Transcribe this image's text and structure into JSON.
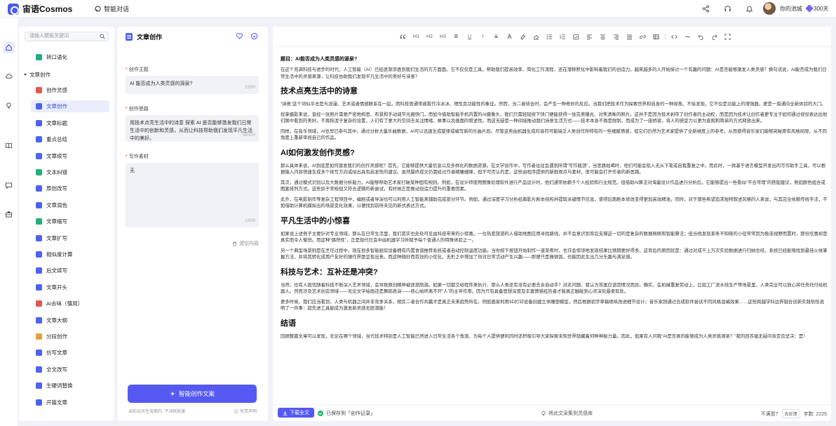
{
  "app": {
    "name": "宙语Cosmos",
    "top_tab": "智能对话",
    "user_name": "你的池城",
    "points": "300天"
  },
  "menu": {
    "search_placeholder": "请输入模板关键词",
    "top_item": "转口语化",
    "group_label": "文章创作",
    "items": [
      {
        "label": "创作灵感",
        "color": "#e2574c"
      },
      {
        "label": "文章创作",
        "color": "#4c63f0"
      },
      {
        "label": "文章标题",
        "color": "#4c63f0"
      },
      {
        "label": "重点总结",
        "color": "#4c63f0"
      },
      {
        "label": "文章续写",
        "color": "#4c63f0"
      },
      {
        "label": "文本纠错",
        "color": "#20b07a"
      },
      {
        "label": "原创改写",
        "color": "#4c63f0"
      },
      {
        "label": "文章润色",
        "color": "#4c63f0"
      },
      {
        "label": "文章缩写",
        "color": "#20b07a"
      },
      {
        "label": "文章扩写",
        "color": "#4c63f0"
      },
      {
        "label": "相似度计算",
        "color": "#4c63f0"
      },
      {
        "label": "后文续写",
        "color": "#4c63f0"
      },
      {
        "label": "文章开头",
        "color": "#4c63f0"
      },
      {
        "label": "AI去味（慎用）",
        "color": "#e2574c"
      },
      {
        "label": "文章大纲",
        "color": "#4c63f0"
      },
      {
        "label": "分段创作",
        "color": "#e2a13a"
      },
      {
        "label": "仿写文章",
        "color": "#4c63f0"
      },
      {
        "label": "全文改写",
        "color": "#4c63f0"
      },
      {
        "label": "生硬词替换",
        "color": "#4c63f0"
      },
      {
        "label": "开篇文章",
        "color": "#4c63f0"
      }
    ]
  },
  "form": {
    "title": "文章创作",
    "topic_label": "创作主题",
    "topic_value": "AI 能否成为人类灵感的源泉?",
    "topic_count": "15/50",
    "idea_label": "创作思路",
    "idea_value": "用技术点亮生活中的诗意 探索 AI 是否能够激发我们日常生活中的创新和灵感，从而让科技帮助我们发现平凡生活中的美好。",
    "idea_count": "58/300",
    "material_label": "写作素材",
    "material_value": "无",
    "material_count": "1/500",
    "clear_label": "清空内容",
    "generate_label": "智能创作文案",
    "foot_note": "当前会员生效期内, 不消耗能量",
    "disclaimer": "免责声明"
  },
  "editor": {
    "toolbar": [
      "H1",
      "H2",
      "H3",
      "B",
      "U",
      "I",
      "S"
    ],
    "doc_title": "题目：AI能否成为人类灵感的源泉?",
    "intro": "在这个充满科技与进步的时代，人工智能（AI）已经逐渐渗透到我们生活的方方面面。它不仅仅是工具，帮助我们提高效率、简化工作流程，还在潜移默化中影响着我们的创造力。越来越多的人开始探讨一个有趣的问题：AI是否能够激发人类灵感？换句话说，AI能否成为我们日常生活中的灵感来源，让科技协助我们发现平凡生活中的美好与诗意？",
    "sections": [
      {
        "heading": "技术点亮生活中的诗意",
        "paragraphs": [
          "“诗意”这个词似乎总是与浪漫、艺术或者情感联系在一起，而科技则通常被看作冷冰冰、理性且功能性的象征。然而，当二者结合时，会产生一种奇妙的反应。当我们把技术作为探索世界和自身的一种视角、不俗发现，它不仅是功能上的增强器，更是一扇通向全新体验的大门。",
          "就拿摄影来说，曾经一张照片需要严密地构思、布景和手动调节光圈快门，而如今借助智能手机内置的AI摄像头，我们只需轻轻按下快门便能获得一张完美曝光、对焦清晰的照片。这并不是因为技术剥夺了创作者的主动权，而是因为技术让创作者更专注于如何通过视觉表达出他们眼中看到的美好。不再拘泥于复杂的设置，人们有了更大的空间去关注情绪、故事以及画面的叙述性。而这无疑是一种间接推动我们诗意生活方式——技术本身不再是限制，而成为了一座桥梁，将人的感受力以更为直观和简单的方式释放出来。",
          "同样，在音乐领域，AI也早已参与其中，通过分析大量乐曲数据，AI可以迅速生成旋律或编写新的乐曲片段。尽管这些由机器生成的音符可能缺乏人类创作所特有的一些细腻情感，但它们仍然为艺术家提供了全新维度上的参考，从而使得音乐家们能够突破原有风格局限，从不同角度上重新审视自己的作品。"
        ]
      },
      {
        "heading": "AI如何激发创作灵感?",
        "paragraphs": [
          "那么具体来说，AI到底是如何激发我们的创作灵感呢？首先，它能够提供大量信息以及多样化的数据资源。在文学创作中，写作者往往会遇到所谓“写作瓶颈”，当思路枯竭时，他们可能会陷入无从下笔或自我重复之中。而此时，一款基于语言模型开发出的写作助手工具，可以根据输入内容快速生成多个续写方向或给出具有启发性的建议。虽然最终成文仍需经过作者精雕细琢，但不可否认的是，这些由程序提供的新鲜观点与素材，很可能会打开作者的新思路。",
          "其次，通过模式识别以及大数据分析能力，AI能够帮助艺术家打破某种固有规则。例如，在设计师使用图像处理软件进行产品设计时，他们通常依赖于个人经验和行业规范。但借助AI算法对海量设计作品进行分析后，它能够提出一些看似“不合常理”的搭配建议，例如颜色组合或图案排列方式。这些异于常规但又符合逻辑的新尝试，有时候正是推动创造力提升的重要因素。",
          "此外，在电影制作等复杂工程项目中，编剧或者导演也可以利用人工智能来辅助完成部分环节。例如，通过深度学习分析经典影片剧本结构并提取关键情节信息，使得后期剧本修改变得更加高效精准。同时，对于那些希望追求独特叙述风格的人来说，与其完全依赖传统手法，不如借助计算机模拟出的场景变化效果，以便找到前所未见的新式表达方式。"
        ]
      },
      {
        "heading": "平凡生活中的小惊喜",
        "paragraphs": [
          "如果说上述例子主要针对专业领域，那么在日常生活里，我们其实也处处可见由科技带来的小惊喜。一位热爱旅游的人借助地图应用寻找路线，并不会意识到背后支撑这一切的是复杂的数据网络和智能算法；但当他发现某条不知晓的小径常常因为极佳视野而置时，那份欣喜却是真实而令人愉悦。而这种“偶然性”，正是现代社会中由机器学习所赋予每个普通人的特殊体验之一。",
          "另一个典型场景则是在烹饪过程中，现在很多智能厨房设备拥有内置食谱推荐系统或者自动控制温度功能。当你按下按钮开始制作一道菜肴时，也许会惊讶地发现结果比预期要好得多。这背后的原因就是：通过对成千上万次实验数据进行归纳总结，系统已经能够找到最佳火候掌握方法，并将其转化成用户友好的操作界面呈现出来。而这种微妙而有效的小优化，无形之中增加了你对日常活动产生兴趣——即便只是做顿饭，也能因此生出几分乐趣与满足感。"
        ]
      },
      {
        "heading": "科技与艺术：互补还是冲突?",
        "paragraphs": [
          "当然，也有人担忧随着科技不断深入艺术领域，会导致原创精神被逐渐削弱。如果一切都交给程序来执行，那么人类还有没有必要去亲自动手？对此问题，我认为答案应该因情况而异。确实，在机械重复劳动上，比如工厂流水线生产等场景里，人类完全可以放心将任务托付给机器人。然而涉及艺术创造领域——无论文学绘画还是舞蹈表演——核心始终离不开“人”的主导作用。因为只有具备思想深度及丰富情感经历者才能真正触碰到心灵深处最柔软处。",
          "更多时候，我们应当看到，人类与机器之间并非竞争关系，相反二者合作共赢才是真正未来趋势所在。例如画家利用3D打印设备创建立体雕塑模型，然后根据初步草稿继续改进细节设计；音乐家则通过合成软件尝试不同风格混编效果……这些跨越学科边界融合创新实践恰恰说明了一件事：超先进工具能成为激发新灵感无限潜能！"
        ]
      },
      {
        "heading": "结语",
        "paragraphs": [
          "回顾整篇文章可以发现，无论在哪个领域，当代技术特别是人工智能已然进入日常生活各个角落，为每个人提供便利同时还积极引导大家探索未知世界隐藏着何种神秘力量。因此，如果有人问我“AI是否真的能够成为人类灵感源泉？”我的回答毫无疑问肯定且坚决：是！"
        ]
      }
    ],
    "download_label": "下载全文",
    "saved_text": "已保存到「创作记录」",
    "collect_text": "将此文采集到灵感库",
    "satisfied_label": "不满意?",
    "feedback_label": "去反馈",
    "word_count_label": "字数: 2225"
  }
}
